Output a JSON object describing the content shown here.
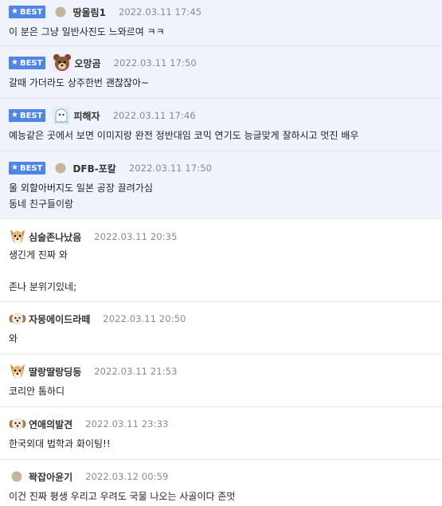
{
  "comments": [
    {
      "best": true,
      "badge": "BEST",
      "avatar": "dot-avatar-icon",
      "nick": "땅울림1",
      "date": "2022.03.11 17:45",
      "lines": [
        "이 분은 그냥 일반사진도 느와르여 ㅋㅋ"
      ]
    },
    {
      "best": true,
      "badge": "BEST",
      "avatar": "bear-avatar-icon",
      "nick": "오망곰",
      "date": "2022.03.11 17:50",
      "lines": [
        "갈때 가더라도 상주한번 괜찮잖아~"
      ]
    },
    {
      "best": true,
      "badge": "BEST",
      "avatar": "ghost-avatar-icon",
      "nick": "피해자",
      "date": "2022.03.11 17:46",
      "lines": [
        "예능같은 곳에서 보면 이미지랑 완전 정반대임 코믹 연기도 능글맞게 잘하시고 멋진 배우"
      ]
    },
    {
      "best": true,
      "badge": "BEST",
      "avatar": "dot-avatar-icon",
      "nick": "DFB-포칼",
      "date": "2022.03.11 17:50",
      "lines": [
        "울 외할아버지도 일본 공장 끌려가심",
        "동네 친구들이랑"
      ]
    },
    {
      "best": false,
      "badge": "",
      "avatar": "dog-avatar-icon",
      "nick": "심술존나났음",
      "date": "2022.03.11 20:35",
      "lines": [
        "생긴게 진짜 와",
        "",
        "존나 분위기있네;"
      ]
    },
    {
      "best": false,
      "badge": "",
      "avatar": "puppy-avatar-icon",
      "nick": "자몽에이드라떼",
      "date": "2022.03.11 20:50",
      "lines": [
        "와"
      ]
    },
    {
      "best": false,
      "badge": "",
      "avatar": "dog-avatar-icon",
      "nick": "딸랑딸랑딩동",
      "date": "2022.03.11 21:53",
      "lines": [
        "코리안 톰하디"
      ]
    },
    {
      "best": false,
      "badge": "",
      "avatar": "puppy-avatar-icon",
      "nick": "연애의발견",
      "date": "2022.03.11 23:33",
      "lines": [
        "한국외대 법학과 화이팅!!"
      ]
    },
    {
      "best": false,
      "badge": "",
      "avatar": "dot-avatar-icon",
      "nick": "꽉잡아윤기",
      "date": "2022.03.12 00:59",
      "lines": [
        "이건 진짜 평생 우리고 우려도 국물 나오는 사골이다 존멋"
      ]
    }
  ],
  "colors": {
    "best_bg": "#f0f3fb",
    "badge_bg": "#4f86e6",
    "date": "#8a8a8a"
  }
}
